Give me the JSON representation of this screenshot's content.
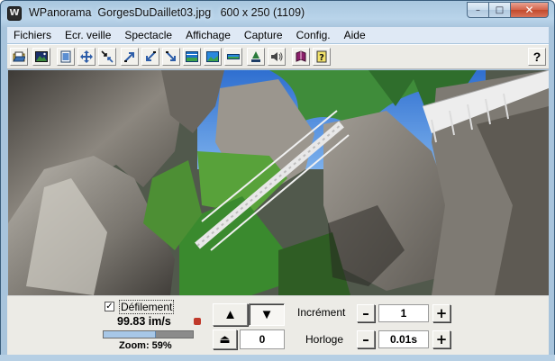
{
  "window": {
    "title": "WPanorama  GorgesDuDaillet03.jpg   600 x 250 (1109)",
    "app_icon_glyph": "W",
    "caption_buttons": {
      "minimize": "–",
      "maximize": "□",
      "close": "✕"
    }
  },
  "menu": [
    "Fichiers",
    "Ecr. veille",
    "Spectacle",
    "Affichage",
    "Capture",
    "Config.",
    "Aide"
  ],
  "toolbar": {
    "buttons": [
      "open-folder-icon",
      "image-icon",
      "page-icon",
      "move-icon",
      "shrink-icon",
      "arrow-ne-icon",
      "arrow-sw-icon",
      "arrow-se-icon",
      "panorama-icon",
      "panorama-wide-icon",
      "panorama-strip-icon",
      "stop-icon",
      "speaker-icon",
      "book-icon",
      "help-file-icon"
    ],
    "help_glyph": "?"
  },
  "colors": {
    "title_bar": "#b9d4ea",
    "menu_bar": "#dfe9f5",
    "panel": "#ecebe6",
    "accent_blue": "#a7c7e7",
    "close_red": "#d4634a"
  },
  "controls": {
    "scroll_checkbox": {
      "checked": true,
      "mark": "✓",
      "label": "Défilement"
    },
    "speed": "99.83 im/s",
    "zoom": {
      "label": "Zoom: 59%",
      "value": 0.59
    },
    "direction": {
      "up": "▲",
      "down": "▼",
      "jump": "⏏",
      "position": "0"
    },
    "increment": {
      "label": "Incrément",
      "value": "1",
      "minus": "–",
      "plus": "+"
    },
    "clock": {
      "label": "Horloge",
      "value": "0.01s",
      "minus": "–",
      "plus": "+"
    }
  }
}
